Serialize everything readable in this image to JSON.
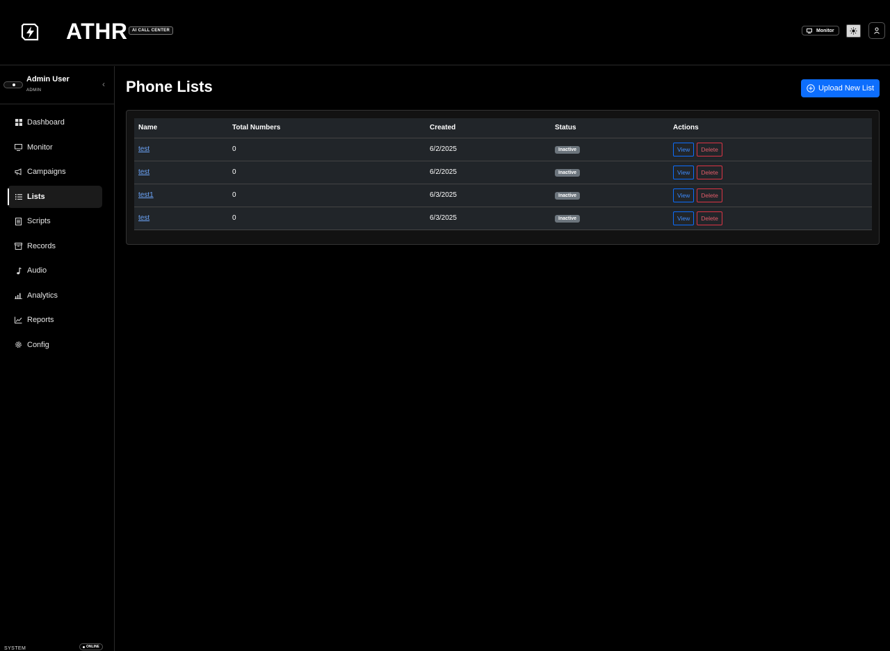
{
  "header": {
    "brand": "ATHR",
    "tagline": "AI CALL CENTER",
    "monitor_label": "Monitor"
  },
  "sidebar": {
    "user_name": "Admin User",
    "user_role": "ADMIN",
    "items": [
      {
        "label": "Dashboard",
        "icon": "grid-icon"
      },
      {
        "label": "Monitor",
        "icon": "monitor-icon"
      },
      {
        "label": "Campaigns",
        "icon": "megaphone-icon"
      },
      {
        "label": "Lists",
        "icon": "list-icon",
        "active": true
      },
      {
        "label": "Scripts",
        "icon": "document-icon"
      },
      {
        "label": "Records",
        "icon": "archive-icon"
      },
      {
        "label": "Audio",
        "icon": "music-note-icon"
      },
      {
        "label": "Analytics",
        "icon": "bar-chart-icon"
      },
      {
        "label": "Reports",
        "icon": "line-chart-icon"
      },
      {
        "label": "Config",
        "icon": "gear-icon"
      }
    ],
    "system_label": "SYSTEM",
    "system_status": "ONLINE"
  },
  "main": {
    "title": "Phone Lists",
    "upload_button": "Upload New List",
    "table": {
      "columns": [
        "Name",
        "Total Numbers",
        "Created",
        "Status",
        "Actions"
      ],
      "rows": [
        {
          "name": "test",
          "total": "0",
          "created": "6/2/2025",
          "status": "Inactive",
          "view": "View",
          "delete": "Delete"
        },
        {
          "name": "test",
          "total": "0",
          "created": "6/2/2025",
          "status": "Inactive",
          "view": "View",
          "delete": "Delete"
        },
        {
          "name": "test1",
          "total": "0",
          "created": "6/3/2025",
          "status": "Inactive",
          "view": "View",
          "delete": "Delete"
        },
        {
          "name": "test",
          "total": "0",
          "created": "6/3/2025",
          "status": "Inactive",
          "view": "View",
          "delete": "Delete"
        }
      ]
    }
  },
  "colors": {
    "primary": "#0d6efd",
    "danger": "#dc3545",
    "badge_inactive": "#6c757d",
    "table_bg": "#212529",
    "background": "#000000"
  }
}
